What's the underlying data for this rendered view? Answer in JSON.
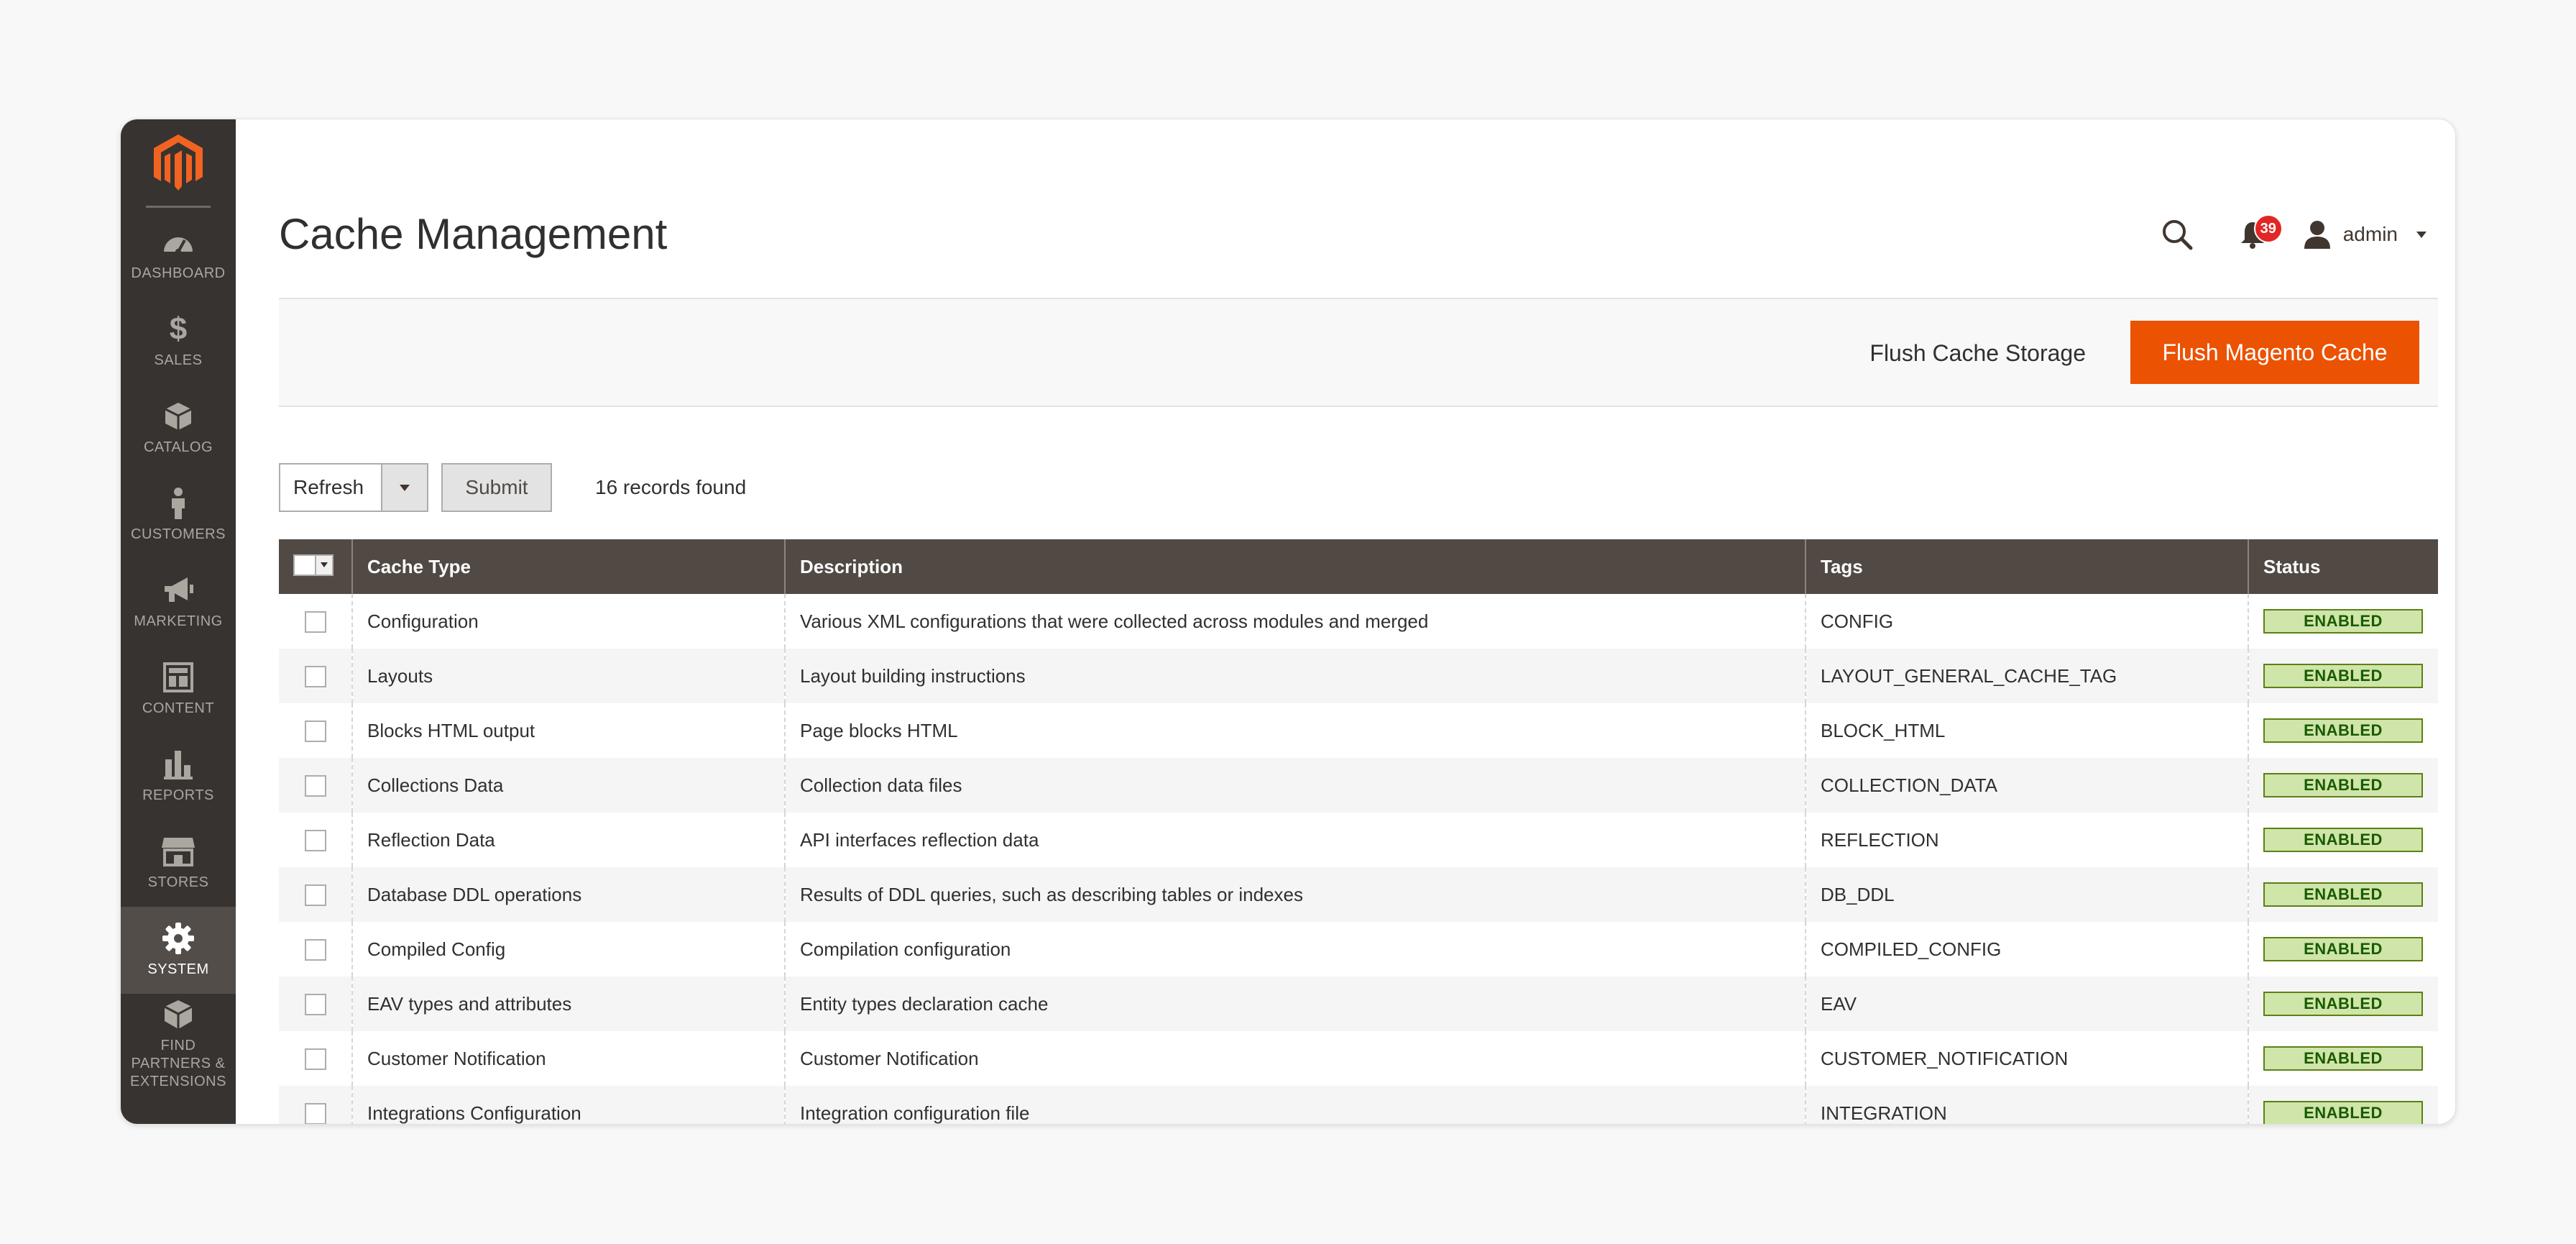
{
  "app": {
    "brand_color": "#eb5202",
    "sidebar_bg": "#373330"
  },
  "sidebar": {
    "logo_icon": "magento-logo",
    "items": [
      {
        "label": "DASHBOARD",
        "icon": "dashboard-icon"
      },
      {
        "label": "SALES",
        "icon": "dollar-icon"
      },
      {
        "label": "CATALOG",
        "icon": "cube-icon"
      },
      {
        "label": "CUSTOMERS",
        "icon": "person-icon"
      },
      {
        "label": "MARKETING",
        "icon": "megaphone-icon"
      },
      {
        "label": "CONTENT",
        "icon": "layout-icon"
      },
      {
        "label": "REPORTS",
        "icon": "bar-chart-icon"
      },
      {
        "label": "STORES",
        "icon": "storefront-icon"
      },
      {
        "label": "SYSTEM",
        "icon": "gear-icon",
        "active": true
      },
      {
        "label": "FIND PARTNERS & EXTENSIONS",
        "icon": "cubes-icon"
      }
    ]
  },
  "header": {
    "title": "Cache Management",
    "notifications_count": "39",
    "user_name": "admin"
  },
  "page_actions": {
    "flush_storage_label": "Flush Cache Storage",
    "flush_magento_label": "Flush Magento Cache"
  },
  "toolbar": {
    "mass_action_value": "Refresh",
    "submit_label": "Submit",
    "records_found": "16 records found"
  },
  "grid": {
    "columns": [
      "Cache Type",
      "Description",
      "Tags",
      "Status"
    ],
    "rows": [
      {
        "type": "Configuration",
        "description": "Various XML configurations that were collected across modules and merged",
        "tags": "CONFIG",
        "status": "ENABLED"
      },
      {
        "type": "Layouts",
        "description": "Layout building instructions",
        "tags": "LAYOUT_GENERAL_CACHE_TAG",
        "status": "ENABLED"
      },
      {
        "type": "Blocks HTML output",
        "description": "Page blocks HTML",
        "tags": "BLOCK_HTML",
        "status": "ENABLED"
      },
      {
        "type": "Collections Data",
        "description": "Collection data files",
        "tags": "COLLECTION_DATA",
        "status": "ENABLED"
      },
      {
        "type": "Reflection Data",
        "description": "API interfaces reflection data",
        "tags": "REFLECTION",
        "status": "ENABLED"
      },
      {
        "type": "Database DDL operations",
        "description": "Results of DDL queries, such as describing tables or indexes",
        "tags": "DB_DDL",
        "status": "ENABLED"
      },
      {
        "type": "Compiled Config",
        "description": "Compilation configuration",
        "tags": "COMPILED_CONFIG",
        "status": "ENABLED"
      },
      {
        "type": "EAV types and attributes",
        "description": "Entity types declaration cache",
        "tags": "EAV",
        "status": "ENABLED"
      },
      {
        "type": "Customer Notification",
        "description": "Customer Notification",
        "tags": "CUSTOMER_NOTIFICATION",
        "status": "ENABLED"
      },
      {
        "type": "Integrations Configuration",
        "description": "Integration configuration file",
        "tags": "INTEGRATION",
        "status": "ENABLED"
      }
    ]
  }
}
